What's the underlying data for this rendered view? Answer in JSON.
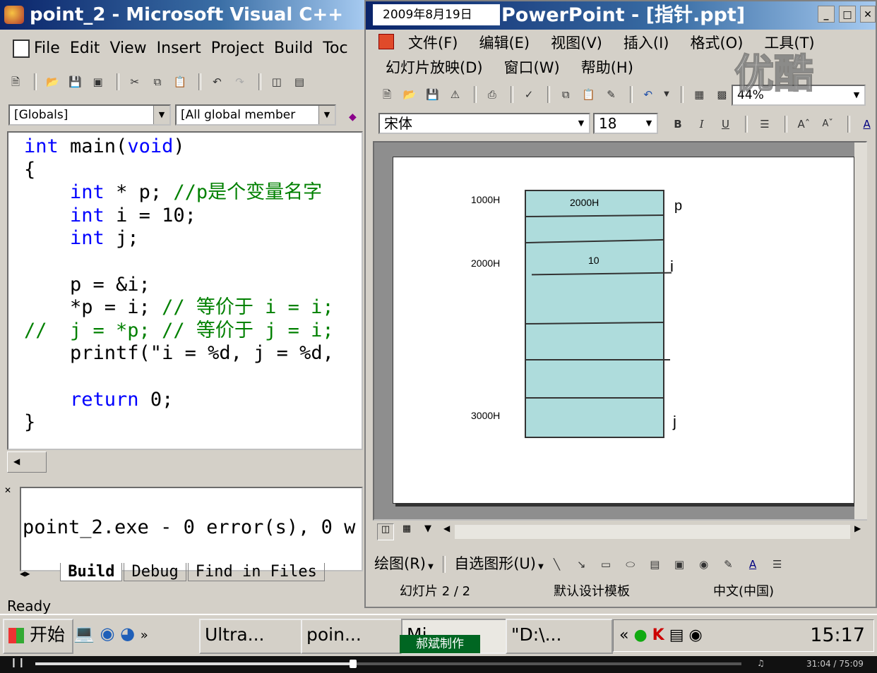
{
  "vc": {
    "title": "point_2 - Microsoft Visual C++",
    "menu": [
      "File",
      "Edit",
      "View",
      "Insert",
      "Project",
      "Build",
      "Toc"
    ],
    "combo_globals": "[Globals]",
    "combo_members": "[All global member",
    "code_lines": [
      {
        "parts": [
          {
            "t": "int",
            "c": "kw"
          },
          {
            "t": " main(",
            "c": ""
          },
          {
            "t": "void",
            "c": "kw"
          },
          {
            "t": ")",
            "c": ""
          }
        ]
      },
      {
        "parts": [
          {
            "t": "{",
            "c": ""
          }
        ]
      },
      {
        "parts": [
          {
            "t": "    ",
            "c": ""
          },
          {
            "t": "int",
            "c": "kw"
          },
          {
            "t": " * p; ",
            "c": ""
          },
          {
            "t": "//p是个变量名字",
            "c": "cm"
          }
        ]
      },
      {
        "parts": [
          {
            "t": "    ",
            "c": ""
          },
          {
            "t": "int",
            "c": "kw"
          },
          {
            "t": " i = 10;",
            "c": ""
          }
        ]
      },
      {
        "parts": [
          {
            "t": "    ",
            "c": ""
          },
          {
            "t": "int",
            "c": "kw"
          },
          {
            "t": " j;",
            "c": ""
          }
        ]
      },
      {
        "parts": [
          {
            "t": "",
            "c": ""
          }
        ]
      },
      {
        "parts": [
          {
            "t": "    p = &i;",
            "c": ""
          }
        ]
      },
      {
        "parts": [
          {
            "t": "    *p = i; ",
            "c": ""
          },
          {
            "t": "// 等价于 i = i;",
            "c": "cm"
          }
        ]
      },
      {
        "parts": [
          {
            "t": "//  j = *p; // 等价于 j = i;",
            "c": "cm"
          }
        ]
      },
      {
        "parts": [
          {
            "t": "    printf(\"i = %d, j = %d,",
            "c": ""
          }
        ]
      },
      {
        "parts": [
          {
            "t": "",
            "c": ""
          }
        ]
      },
      {
        "parts": [
          {
            "t": "    ",
            "c": ""
          },
          {
            "t": "return",
            "c": "kw"
          },
          {
            "t": " 0;",
            "c": ""
          }
        ]
      },
      {
        "parts": [
          {
            "t": "}",
            "c": ""
          }
        ]
      }
    ],
    "output_text": "point_2.exe - 0 error(s), 0 w",
    "output_tabs": [
      "Build",
      "Debug",
      "Find in Files"
    ],
    "status": "Ready"
  },
  "ppt": {
    "date": "2009年8月19日",
    "title": "PowerPoint - [指针.ppt]",
    "menu_row1": [
      "文件(F)",
      "编辑(E)",
      "视图(V)",
      "插入(I)",
      "格式(O)",
      "工具(T)"
    ],
    "menu_row2": [
      "幻灯片放映(D)",
      "窗口(W)",
      "帮助(H)"
    ],
    "zoom": "44%",
    "font_name": "宋体",
    "font_size": "18",
    "slide": {
      "addresses": [
        "1000H",
        "2000H",
        "3000H"
      ],
      "cell_values": [
        "2000H",
        "10"
      ],
      "var_labels": [
        "p",
        "i",
        "j"
      ]
    },
    "draw_toolbar": {
      "draw": "绘图(R)",
      "autoshapes": "自选图形(U)"
    },
    "status_slide": "幻灯片 2 / 2",
    "status_template": "默认设计模板",
    "status_lang": "中文(中国)"
  },
  "watermark": "优酷",
  "taskbar": {
    "start": "开始",
    "buttons": [
      "Ultra...",
      "poin...",
      "Mi...",
      "\"D:\\..."
    ],
    "overlay_label": "郝斌制作",
    "clock": "15:17"
  },
  "player": {
    "time": "31:04 / 75:09",
    "progress": 0.45
  }
}
